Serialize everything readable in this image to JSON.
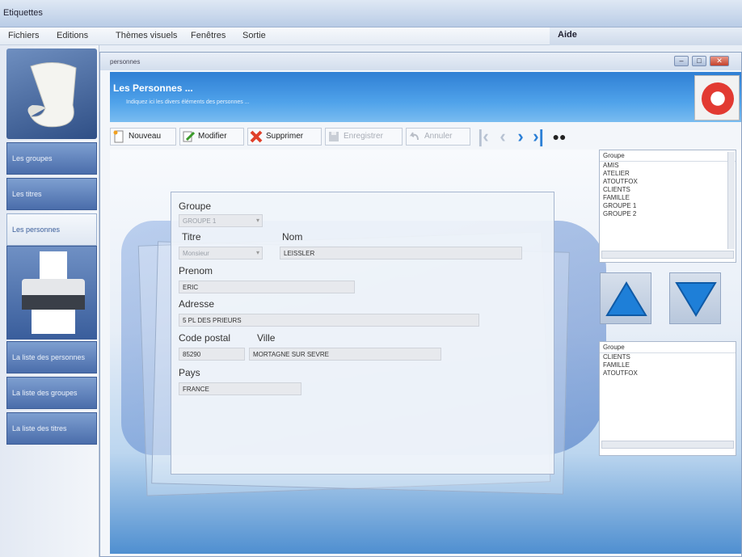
{
  "app": {
    "title": "Etiquettes"
  },
  "menu": {
    "items": [
      "Fichiers",
      "Editions",
      "Thèmes visuels",
      "Fenêtres",
      "Sortie"
    ],
    "help": "Aide"
  },
  "sidebar": {
    "buttons": [
      "Les groupes",
      "Les titres",
      "Les personnes",
      "La liste des personnes",
      "La liste des groupes",
      "La liste des titres"
    ],
    "active_index": 2
  },
  "window": {
    "title": "personnes",
    "controls": [
      "minimize",
      "maximize",
      "close"
    ]
  },
  "banner": {
    "title": "Les Personnes ...",
    "subtitle": "Indiquez ici les divers éléments des personnes ...",
    "icon": "help-lifebuoy-icon"
  },
  "toolbar": {
    "nouveau": "Nouveau",
    "modifier": "Modifier",
    "supprimer": "Supprimer",
    "enregistrer": "Enregistrer",
    "annuler": "Annuler",
    "nav_icons": [
      "first-record-icon",
      "previous-record-icon",
      "next-record-icon",
      "last-record-icon",
      "search-binoculars-icon"
    ]
  },
  "form": {
    "groupe_label": "Groupe",
    "groupe_value": "GROUPE 1",
    "titre_label": "Titre",
    "titre_value": "Monsieur",
    "nom_label": "Nom",
    "nom_value": "LEISSLER",
    "prenom_label": "Prenom",
    "prenom_value": "ERIC",
    "adresse_label": "Adresse",
    "adresse_value": "5 PL DES PRIEURS",
    "cp_label": "Code postal",
    "cp_value": "85290",
    "ville_label": "Ville",
    "ville_value": "MORTAGNE SUR SEVRE",
    "pays_label": "Pays",
    "pays_value": "FRANCE"
  },
  "groups_list": {
    "header": "Groupe",
    "items": [
      "AMIS",
      "ATELIER",
      "ATOUTFOX",
      "CLIENTS",
      "FAMILLE",
      "GROUPE 1",
      "GROUPE 2"
    ]
  },
  "assigned_list": {
    "header": "Groupe",
    "items": [
      "CLIENTS",
      "FAMILLE",
      "ATOUTFOX"
    ]
  },
  "colors": {
    "accent": "#3a8ee0",
    "banner": "#2f7fd4",
    "delete": "#e0402a"
  }
}
